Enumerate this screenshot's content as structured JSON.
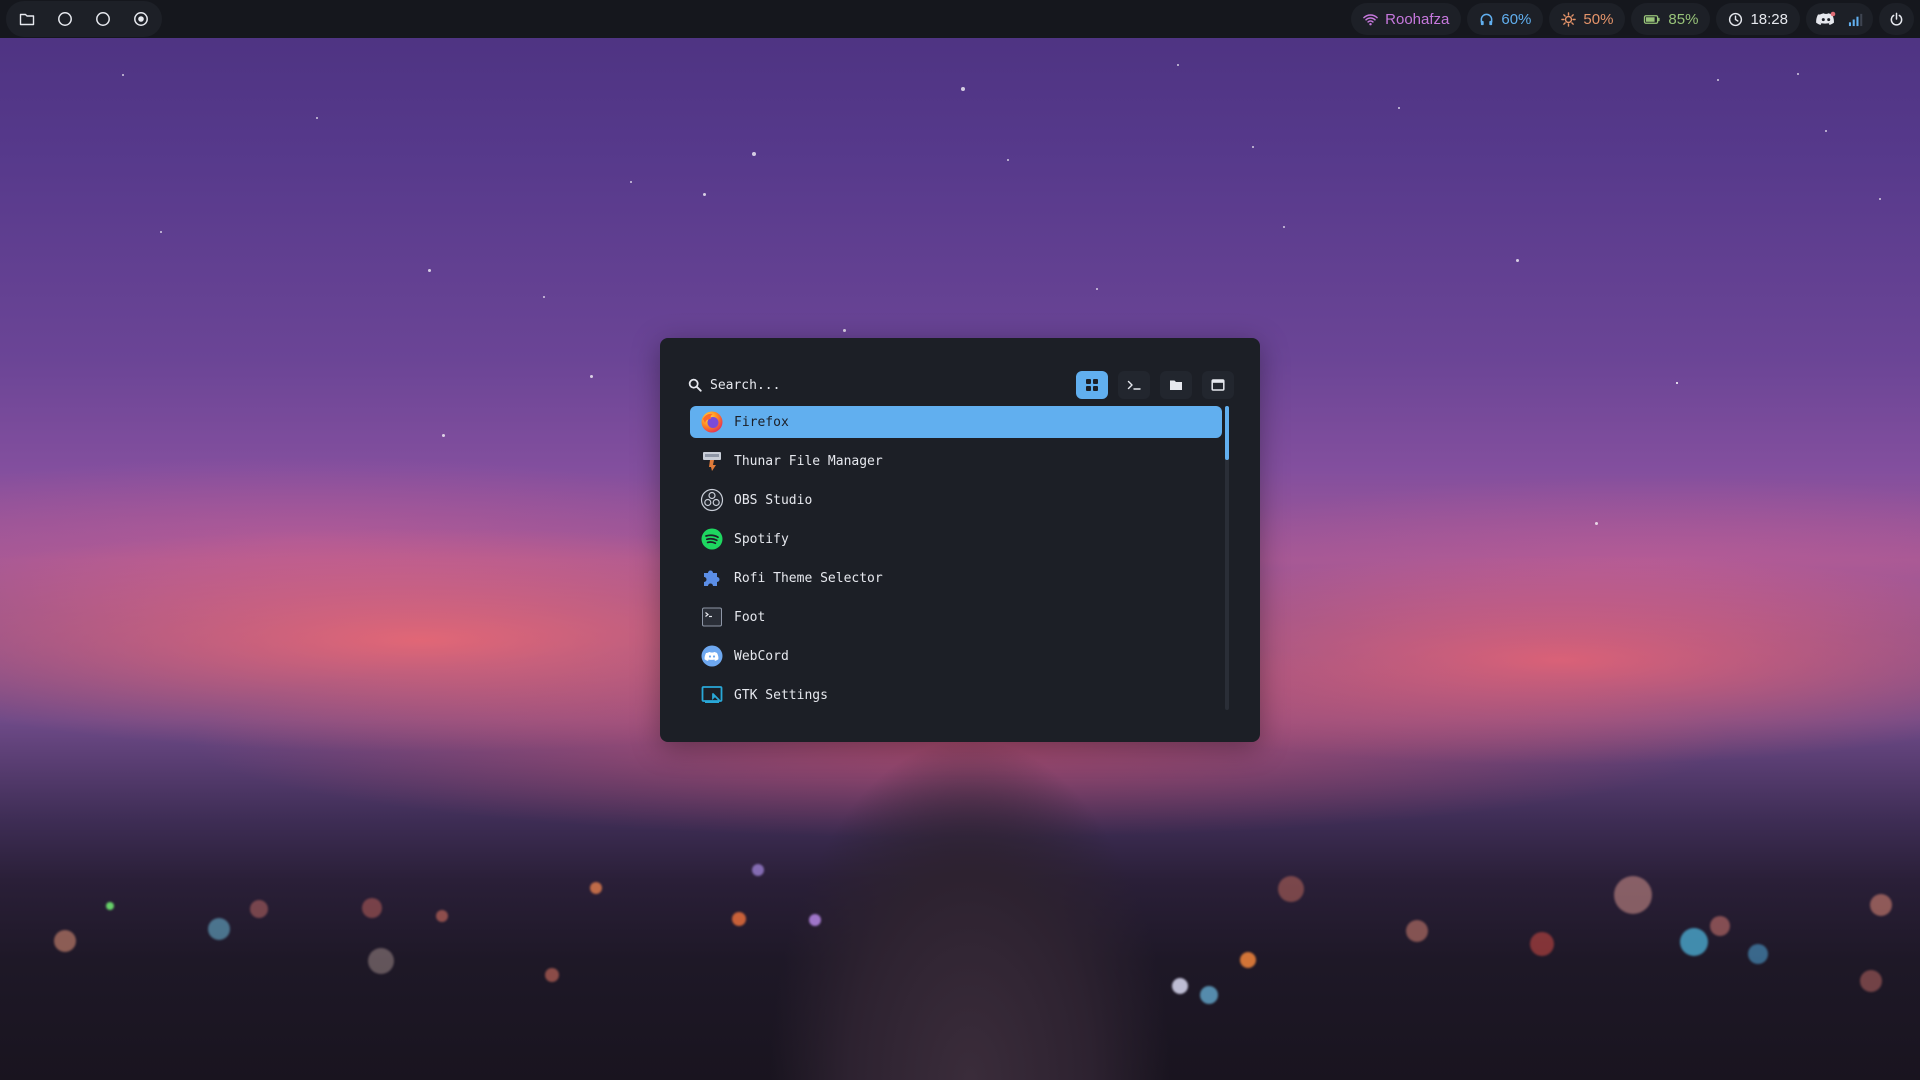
{
  "colors": {
    "accent": "#61afef",
    "panel": "#1c1f26",
    "bar": "#15171d",
    "wifi": "#c678dd",
    "volume": "#61afef",
    "brightness": "#e5946a",
    "battery": "#98c379",
    "clock": "#e6e8ee"
  },
  "topbar": {
    "workspaces": [
      {
        "icon": "folder-icon"
      },
      {
        "icon": "circle-icon"
      },
      {
        "icon": "circle-icon"
      },
      {
        "icon": "dot-circle-icon",
        "active": true
      }
    ],
    "wifi": {
      "icon": "wifi-icon",
      "label": "Roohafza"
    },
    "volume": {
      "icon": "headphones-icon",
      "label": "60%"
    },
    "brightness": {
      "icon": "brightness-icon",
      "label": "50%"
    },
    "battery": {
      "icon": "battery-icon",
      "label": "85%",
      "level": 0.85
    },
    "clock": {
      "icon": "clock-icon",
      "label": "18:28"
    },
    "tray": {
      "icons": [
        "discord-icon",
        "signal-icon"
      ]
    },
    "power": {
      "icon": "power-icon"
    }
  },
  "launcher": {
    "search": {
      "placeholder": "Search...",
      "value": ""
    },
    "modes": [
      {
        "icon": "grid-icon",
        "active": true
      },
      {
        "icon": "terminal-icon",
        "active": false
      },
      {
        "icon": "folder-icon",
        "active": false
      },
      {
        "icon": "window-icon",
        "active": false
      }
    ],
    "items": [
      {
        "label": "Firefox",
        "icon": "firefox-icon",
        "selected": true
      },
      {
        "label": "Thunar File Manager",
        "icon": "thunar-icon"
      },
      {
        "label": "OBS Studio",
        "icon": "obs-icon"
      },
      {
        "label": "Spotify",
        "icon": "spotify-icon"
      },
      {
        "label": "Rofi Theme Selector",
        "icon": "puzzle-icon"
      },
      {
        "label": "Foot",
        "icon": "terminal-app-icon"
      },
      {
        "label": "WebCord",
        "icon": "discord-icon"
      },
      {
        "label": "GTK Settings",
        "icon": "gtk-settings-icon"
      }
    ],
    "scroll_position": 0
  }
}
